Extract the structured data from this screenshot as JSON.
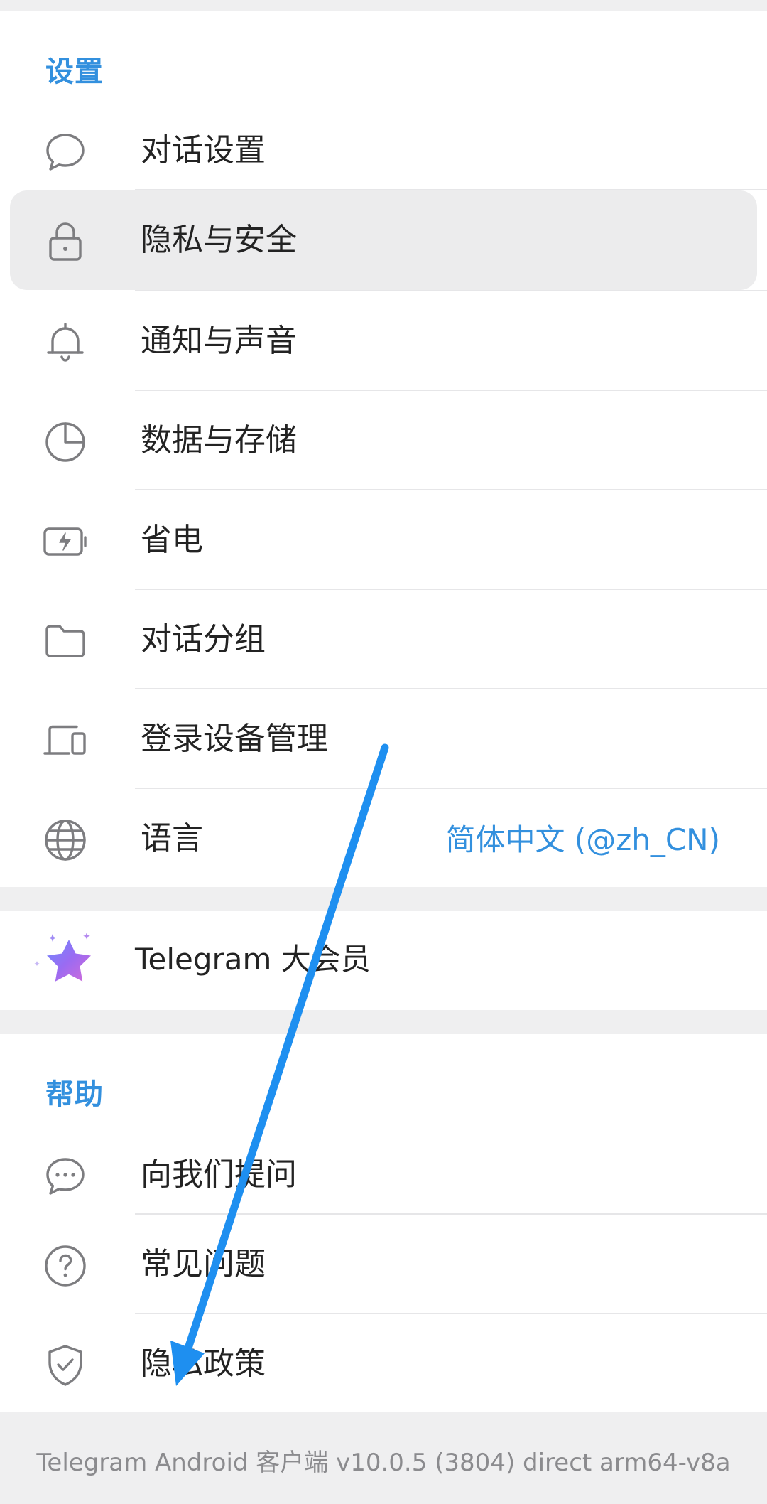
{
  "settings": {
    "title": "设置",
    "items": [
      {
        "label": "对话设置",
        "icon": "chat-bubble-icon"
      },
      {
        "label": "隐私与安全",
        "icon": "lock-icon"
      },
      {
        "label": "通知与声音",
        "icon": "bell-icon"
      },
      {
        "label": "数据与存储",
        "icon": "pie-chart-icon"
      },
      {
        "label": "省电",
        "icon": "battery-icon"
      },
      {
        "label": "对话分组",
        "icon": "folder-icon"
      },
      {
        "label": "登录设备管理",
        "icon": "devices-icon"
      },
      {
        "label": "语言",
        "icon": "globe-icon",
        "value": "简体中文 (@zh_CN)"
      }
    ]
  },
  "premium": {
    "label": "Telegram 大会员",
    "icon": "premium-star-icon"
  },
  "help": {
    "title": "帮助",
    "items": [
      {
        "label": "向我们提问",
        "icon": "chat-dots-icon"
      },
      {
        "label": "常见问题",
        "icon": "question-circle-icon"
      },
      {
        "label": "隐私政策",
        "icon": "shield-check-icon"
      }
    ]
  },
  "footer": {
    "version_text": "Telegram Android 客户端 v10.0.5 (3804) direct arm64-v8a"
  },
  "colors": {
    "accent": "#3390de",
    "annotation_arrow": "#1e8ff0",
    "highlight_row": "#ececed",
    "background": "#efeff0"
  }
}
